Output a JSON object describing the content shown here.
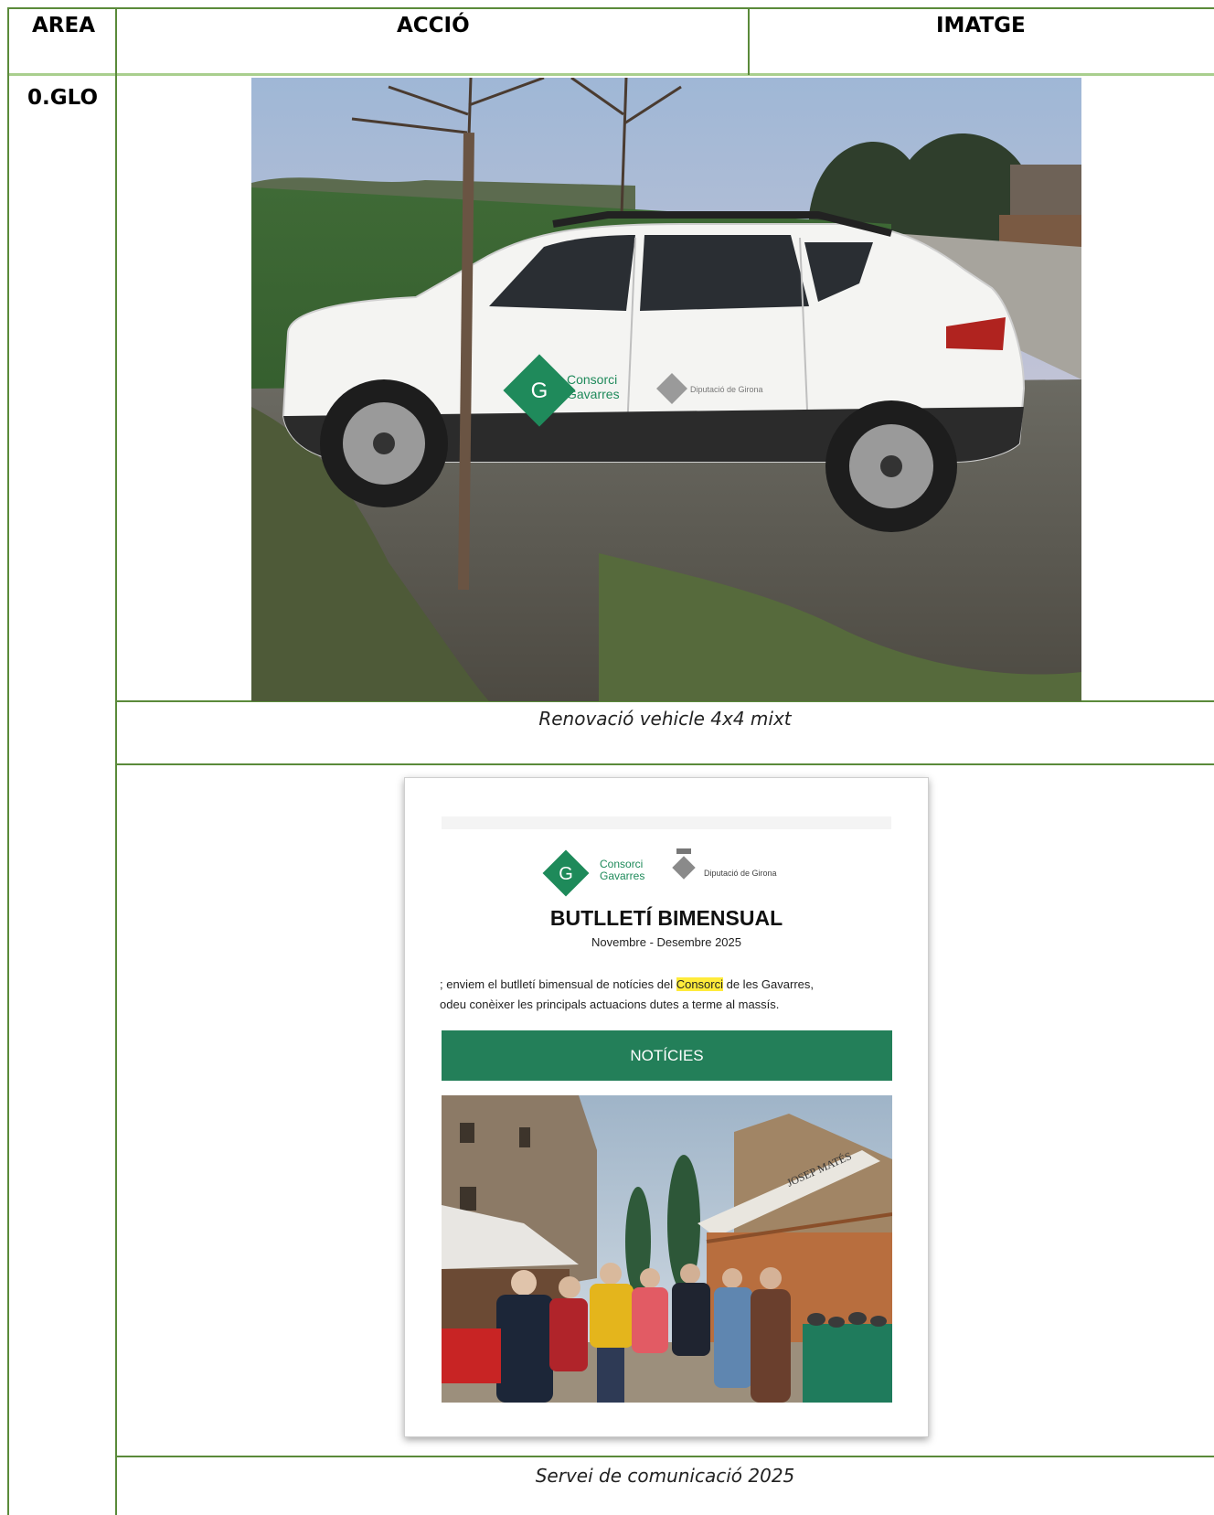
{
  "header": {
    "area": "AREA",
    "accio": "ACCIÓ",
    "imatge": "IMATGE"
  },
  "row": {
    "area": "0.GLO"
  },
  "captions": {
    "vehicle": "Renovació vehicle 4x4 mixt",
    "communication": "Servei de comunicació 2025"
  },
  "vehicle_logos": {
    "consorci": [
      "Consorci",
      "Gavarres"
    ],
    "diputacio": "Diputació de Girona"
  },
  "newsletter": {
    "logo_consorci": [
      "Consorci",
      "Gavarres"
    ],
    "logo_diputacio": "Diputació de Girona",
    "title": "BUTLLETÍ BIMENSUAL",
    "subtitle": "Novembre - Desembre 2025",
    "line1_before": "; enviem el butlletí bimensual de notícies del ",
    "line1_highlight": "Consorci",
    "line1_after": " de les Gavarres, ",
    "line2": "odeu conèixer les principals actuacions dutes a terme al massís.",
    "button": "NOTÍCIES",
    "stall_sign": "JOSEP MATÉS"
  },
  "colors": {
    "border": "#5a8a3a",
    "brand_green": "#237f59",
    "highlight": "#ffeb3b"
  }
}
